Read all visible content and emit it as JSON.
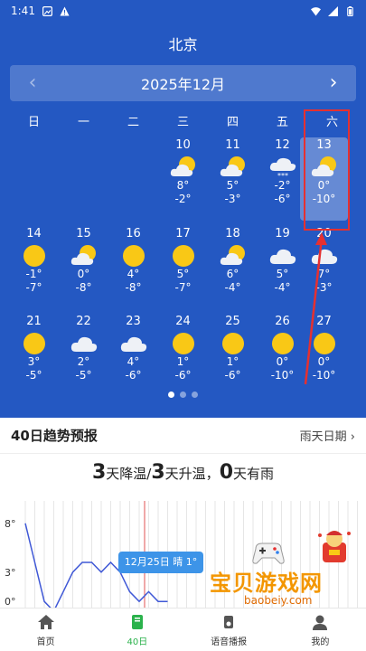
{
  "status": {
    "time": "1:41"
  },
  "header": {
    "city": "北京",
    "month": "2025年12月",
    "prev": "‹",
    "next": "›"
  },
  "weekdays": [
    "日",
    "一",
    "二",
    "三",
    "四",
    "五",
    "六"
  ],
  "days": [
    {
      "date": "10",
      "icon": "partly-cloudy-icon",
      "high": "8°",
      "low": "-2°"
    },
    {
      "date": "11",
      "icon": "partly-cloudy-icon",
      "high": "5°",
      "low": "-3°"
    },
    {
      "date": "12",
      "icon": "snow-icon",
      "high": "-2°",
      "low": "-6°"
    },
    {
      "date": "13",
      "icon": "partly-cloudy-icon",
      "high": "0°",
      "low": "-10°",
      "selected": true
    },
    {
      "date": "14",
      "icon": "sun-icon",
      "high": "-1°",
      "low": "-7°"
    },
    {
      "date": "15",
      "icon": "partly-cloudy-icon",
      "high": "0°",
      "low": "-8°"
    },
    {
      "date": "16",
      "icon": "sun-icon",
      "high": "4°",
      "low": "-8°"
    },
    {
      "date": "17",
      "icon": "sun-icon",
      "high": "5°",
      "low": "-7°"
    },
    {
      "date": "18",
      "icon": "partly-cloudy-icon",
      "high": "6°",
      "low": "-4°"
    },
    {
      "date": "19",
      "icon": "cloud-icon",
      "high": "5°",
      "low": "-4°"
    },
    {
      "date": "20",
      "icon": "cloud-icon",
      "high": "7°",
      "low": "-3°"
    },
    {
      "date": "21",
      "icon": "sun-icon",
      "high": "3°",
      "low": "-5°"
    },
    {
      "date": "22",
      "icon": "cloud-icon",
      "high": "2°",
      "low": "-5°"
    },
    {
      "date": "23",
      "icon": "cloud-icon",
      "high": "4°",
      "low": "-6°"
    },
    {
      "date": "24",
      "icon": "sun-icon",
      "high": "1°",
      "low": "-6°"
    },
    {
      "date": "25",
      "icon": "sun-icon",
      "high": "1°",
      "low": "-6°"
    },
    {
      "date": "26",
      "icon": "sun-icon",
      "high": "0°",
      "low": "-10°"
    },
    {
      "date": "27",
      "icon": "sun-icon",
      "high": "0°",
      "low": "-10°"
    }
  ],
  "trend": {
    "title": "40日趋势预报",
    "rain_link": "雨天日期 ›",
    "summary": {
      "cool_num": "3",
      "cool_text": "天降温/",
      "warm_num": "3",
      "warm_text": "天升温，",
      "rain_num": "0",
      "rain_text": "天有雨"
    },
    "tooltip": "12月25日 晴 1°"
  },
  "chart_data": {
    "type": "line",
    "y_ticks": [
      "8°",
      "3°",
      "0°"
    ],
    "series": [
      {
        "values": [
          8,
          4,
          0,
          -1,
          1,
          3,
          4,
          4,
          3,
          4,
          3,
          1,
          0,
          1,
          0,
          0
        ]
      }
    ]
  },
  "watermark": {
    "name": "宝贝游戏网",
    "url": "baobeiy.com"
  },
  "nav": [
    {
      "label": "首页",
      "icon": "home-icon"
    },
    {
      "label": "40日",
      "icon": "calendar-book-icon",
      "active": true
    },
    {
      "label": "语音播报",
      "icon": "speaker-icon"
    },
    {
      "label": "我的",
      "icon": "user-icon"
    }
  ]
}
